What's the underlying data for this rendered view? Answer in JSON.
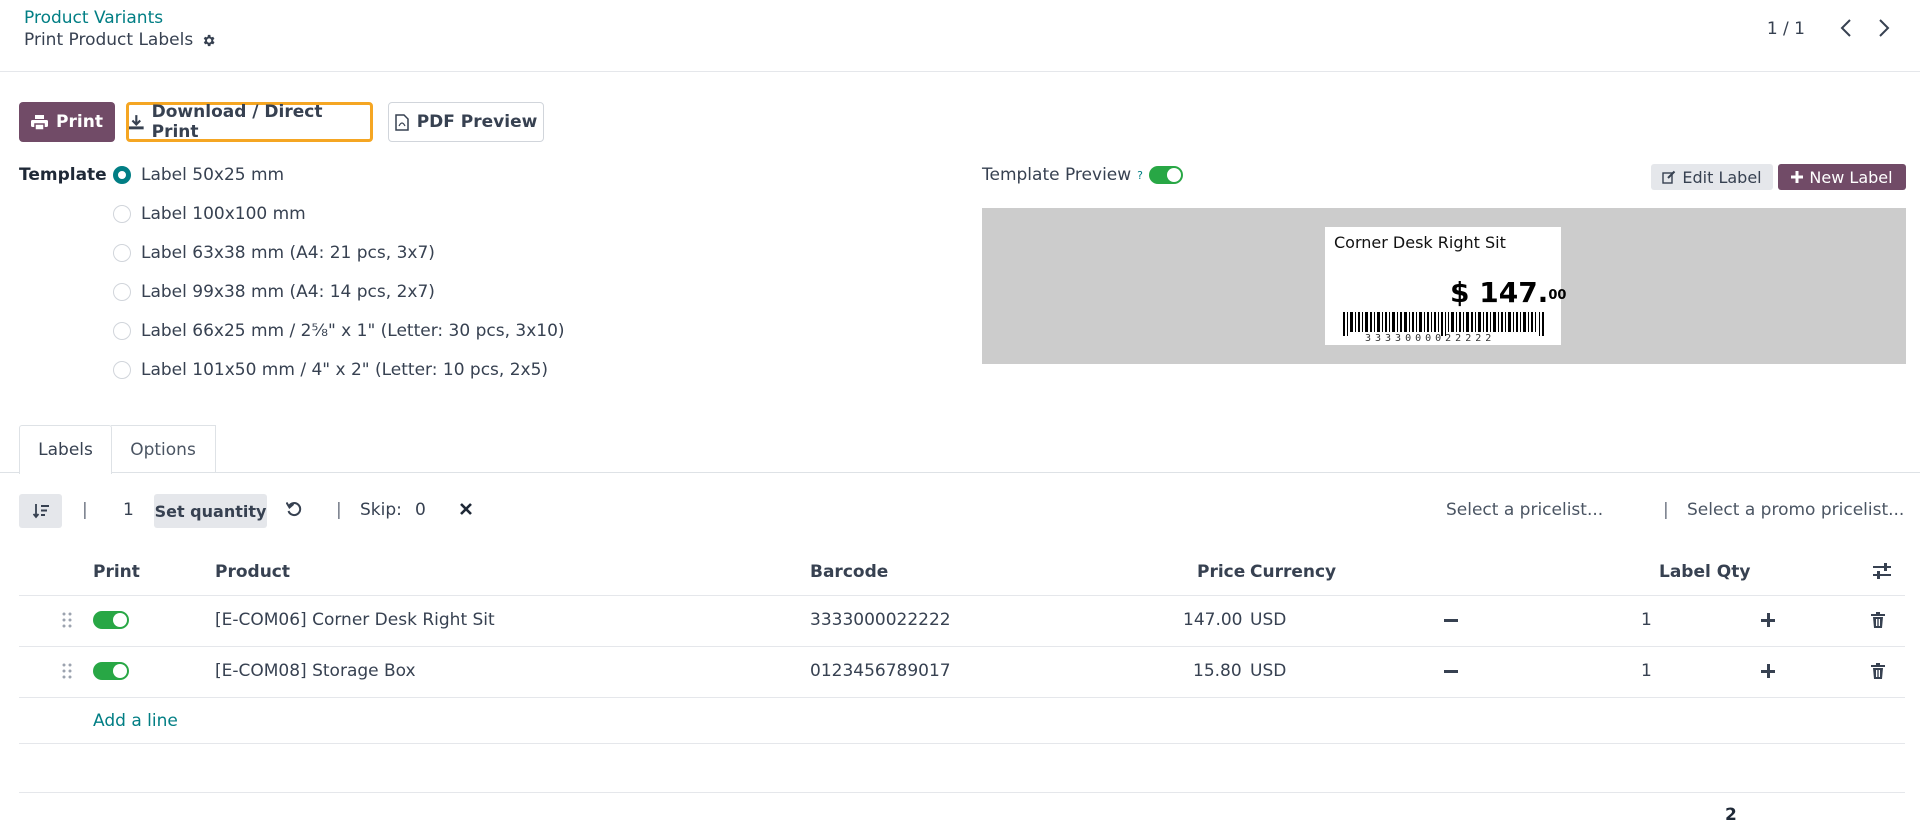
{
  "header": {
    "breadcrumb_parent": "Product Variants",
    "title": "Print Product Labels",
    "pager": "1 / 1"
  },
  "toolbar": {
    "print_label": "Print",
    "download_label": "Download / Direct Print",
    "pdf_label": "PDF Preview"
  },
  "template": {
    "label": "Template",
    "options": [
      {
        "label": "Label 50x25 mm",
        "checked": true
      },
      {
        "label": "Label 100x100 mm",
        "checked": false
      },
      {
        "label": "Label 63x38 mm (A4: 21 pcs, 3x7)",
        "checked": false
      },
      {
        "label": "Label 99x38 mm (A4: 14 pcs, 2x7)",
        "checked": false
      },
      {
        "label": "Label 66x25 mm / 2⅝\" x 1\" (Letter: 30 pcs, 3x10)",
        "checked": false
      },
      {
        "label": "Label 101x50 mm / 4\" x 2\" (Letter: 10 pcs, 2x5)",
        "checked": false
      }
    ]
  },
  "preview": {
    "title": "Template Preview",
    "help": "?",
    "enabled": true,
    "edit_label": "Edit Label",
    "new_label": "New Label",
    "card": {
      "product": "Corner Desk Right Sit",
      "price_main": "$ 147.",
      "price_decimals": "00",
      "barcode_digits": "3333000022222"
    }
  },
  "tabs": {
    "labels": "Labels",
    "options": "Options"
  },
  "list_toolbar": {
    "qty": "1",
    "set_quantity": "Set quantity",
    "skip_label": "Skip:",
    "skip_value": "0",
    "pricelist_placeholder": "Select a pricelist...",
    "promo_pricelist_placeholder": "Select a promo pricelist...",
    "sep": "|"
  },
  "table": {
    "headers": {
      "print": "Print",
      "product": "Product",
      "barcode": "Barcode",
      "price": "Price",
      "currency": "Currency",
      "label_qty": "Label Qty"
    },
    "rows": [
      {
        "print": true,
        "product": "[E-COM06] Corner Desk Right Sit",
        "barcode": "3333000022222",
        "price": "147.00",
        "currency": "USD",
        "qty": "1"
      },
      {
        "print": true,
        "product": "[E-COM08] Storage Box",
        "barcode": "0123456789017",
        "price": "15.80",
        "currency": "USD",
        "qty": "1"
      }
    ],
    "add_line": "Add a line",
    "total_qty": "2"
  },
  "colors": {
    "brand": "#714b67",
    "accent": "#017e84",
    "toggle_on": "#28a745",
    "highlight": "#f5a623"
  }
}
